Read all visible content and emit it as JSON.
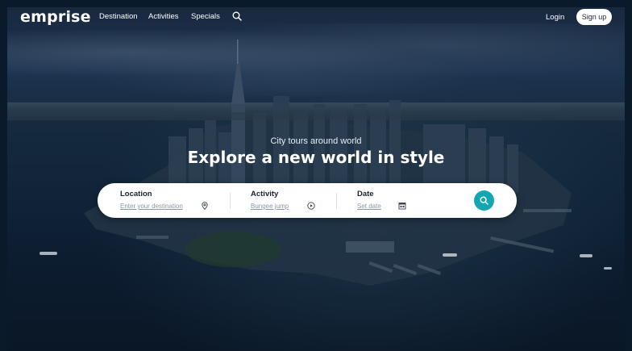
{
  "brand": {
    "logo": "emprise"
  },
  "nav": {
    "links": [
      "Destination",
      "Activities",
      "Specials"
    ],
    "login": "Login",
    "signup": "Sign up"
  },
  "hero": {
    "subtitle": "City tours around world",
    "title": "Explore a new world in style"
  },
  "search": {
    "location": {
      "label": "Location",
      "placeholder": "Enter your destination",
      "icon": "location-pin-icon"
    },
    "activity": {
      "label": "Activity",
      "value": "Bungee jump",
      "icon": "play-circle-icon"
    },
    "date": {
      "label": "Date",
      "placeholder": "Set date",
      "icon": "calendar-icon"
    },
    "submit_icon": "search-icon"
  },
  "colors": {
    "accent": "#14a6b4",
    "background": "#0b1a2a",
    "text_dark": "#1b2230",
    "placeholder": "#8a97a8"
  }
}
